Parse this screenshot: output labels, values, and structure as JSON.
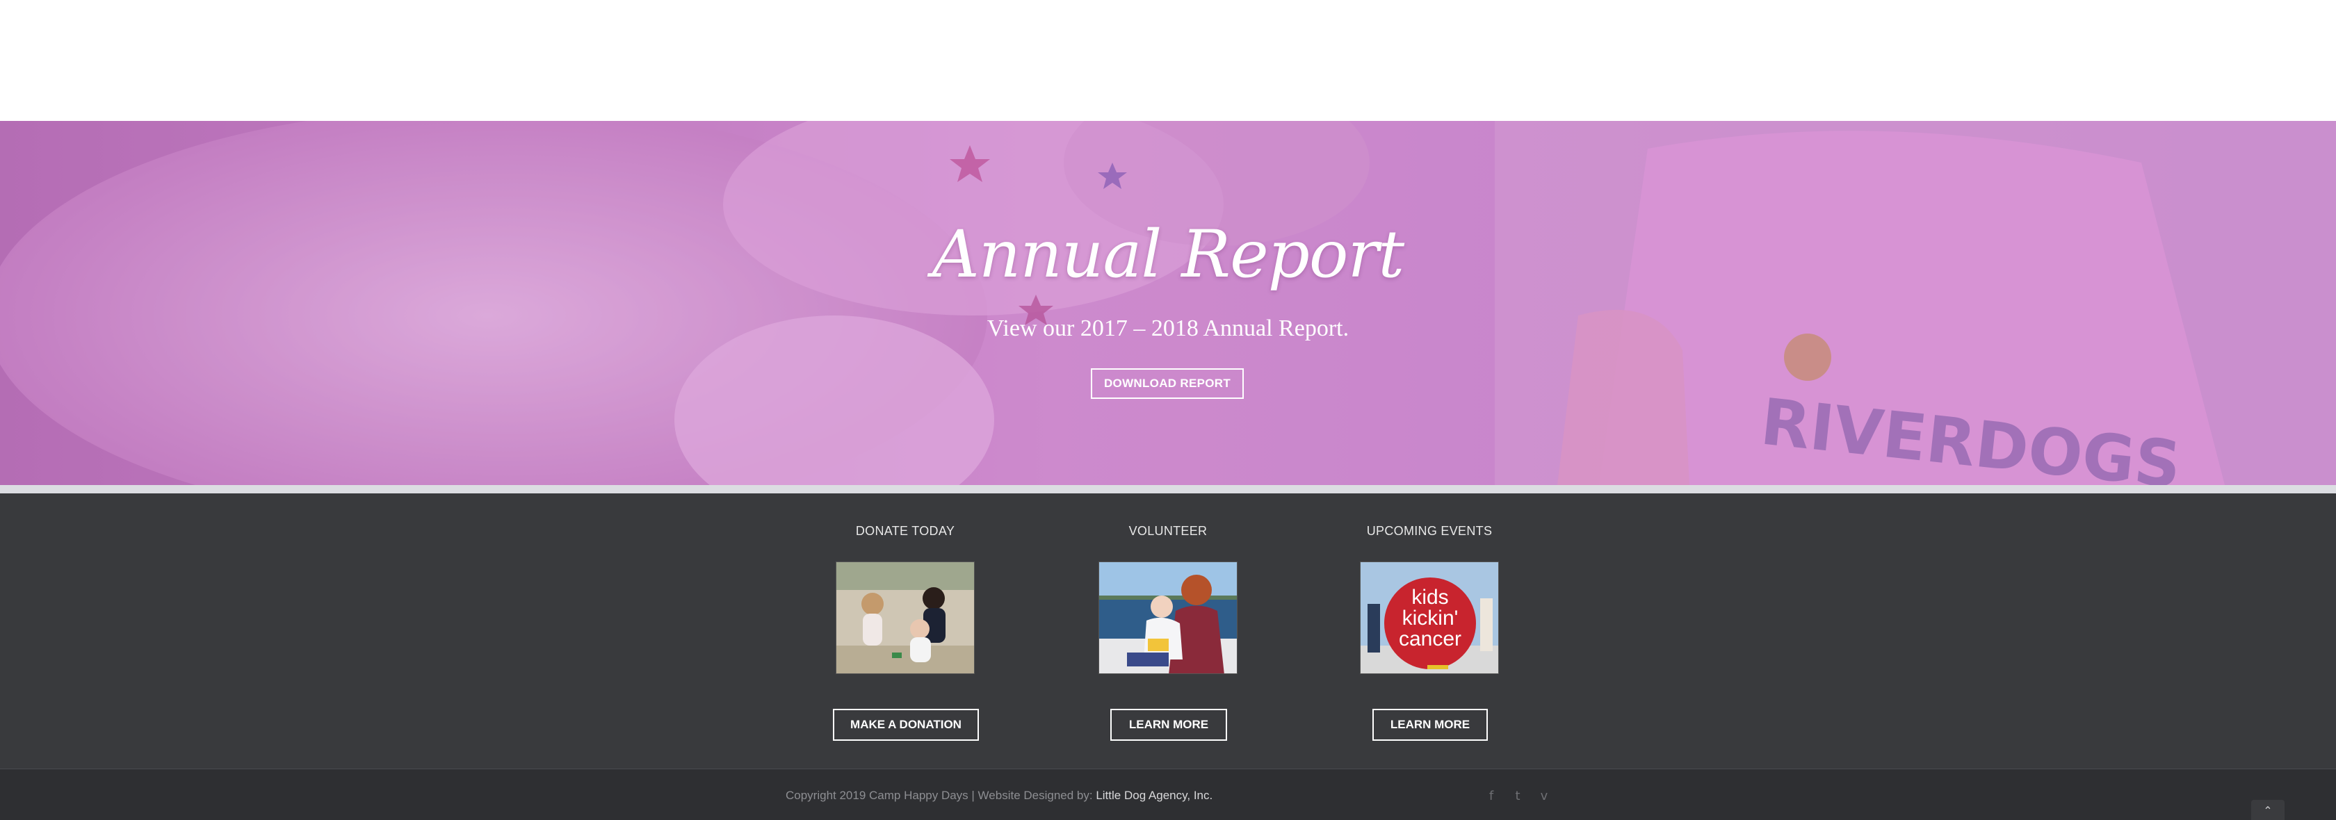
{
  "hero": {
    "title": "Annual Report",
    "subtitle": "View our 2017 – 2018 Annual Report.",
    "button_label": "DOWNLOAD REPORT",
    "shirt_text": "RIVERDOGS"
  },
  "widgets": [
    {
      "heading": "DONATE TODAY",
      "button_label": "MAKE A DONATION"
    },
    {
      "heading": "VOLUNTEER",
      "button_label": "LEARN MORE"
    },
    {
      "heading": "UPCOMING EVENTS",
      "button_label": "LEARN MORE",
      "sail_text": [
        "kids",
        "kickin'",
        "cancer"
      ]
    }
  ],
  "footer": {
    "copyright_text": "Copyright 2019 Camp Happy Days | Website Designed by: ",
    "agency_link": "Little Dog Agency, Inc.",
    "social_icons": [
      "facebook-icon",
      "twitter-icon",
      "vimeo-icon"
    ],
    "social_glyphs": [
      "f",
      "t",
      "v"
    ],
    "to_top_glyph": "⌃"
  },
  "colors": {
    "hero_tint": "#c98ac7",
    "widgets_bg": "#393a3d",
    "bottom_bar_bg": "#2e2f32",
    "divider": "#dcdde2"
  }
}
